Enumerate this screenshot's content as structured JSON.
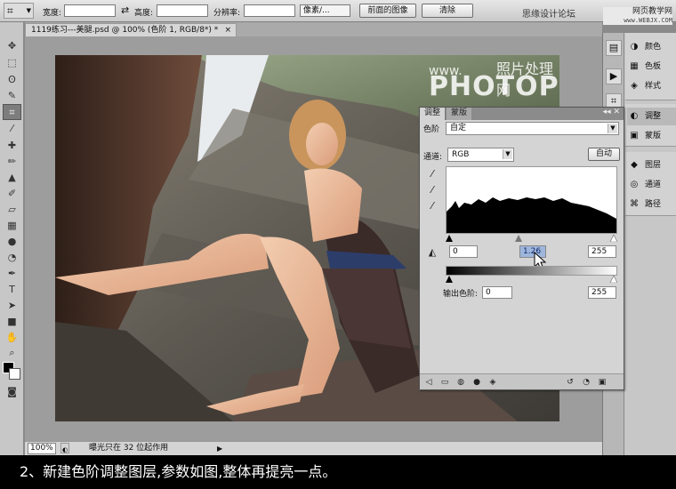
{
  "options_bar": {
    "tool_icon": "crop-icon",
    "width_label": "宽度:",
    "width_value": "",
    "height_label": "高度:",
    "height_value": "",
    "resolution_label": "分辨率:",
    "resolution_value": "",
    "resolution_unit": "像素/...",
    "front_image_button": "前面的图像",
    "clear_button": "清除",
    "watermark_forum": "思缘设计论坛",
    "watermark_site": "网页教学网",
    "watermark_url": "www.WEBJX.COM"
  },
  "document": {
    "tab_title": "1119练习---美腿.psd @ 100% (色阶 1, RGB/8*) *",
    "tab_close": "×",
    "photo_watermark_small": "www.",
    "photo_watermark_cn": "照片处理网",
    "photo_watermark_big": "PHOTOPS.COM"
  },
  "status_bar": {
    "zoom": "100%",
    "info": "曝光只在 32 位起作用",
    "arrow": "▶"
  },
  "adjustments_panel": {
    "tab_adjust": "调整",
    "tab_masks": "蒙版",
    "panel_controls": "◂◂ ✕",
    "preset_label": "色阶",
    "preset_value": "自定",
    "channel_label": "通道:",
    "channel_value": "RGB",
    "auto_button": "自动",
    "input_black": "0",
    "input_gamma": "1.26",
    "input_white": "255",
    "output_label": "输出色阶:",
    "output_black": "0",
    "output_white": "255"
  },
  "dock": {
    "items": [
      {
        "label": "颜色",
        "icon": "color-icon"
      },
      {
        "label": "色板",
        "icon": "swatches-icon"
      },
      {
        "label": "样式",
        "icon": "styles-icon"
      },
      {
        "label": "调整",
        "icon": "adjustments-icon"
      },
      {
        "label": "蒙版",
        "icon": "masks-icon"
      },
      {
        "label": "图层",
        "icon": "layers-icon"
      },
      {
        "label": "通道",
        "icon": "channels-icon"
      },
      {
        "label": "路径",
        "icon": "paths-icon"
      }
    ]
  },
  "caption": "2、新建色阶调整图层,参数如图,整体再提亮一点。"
}
